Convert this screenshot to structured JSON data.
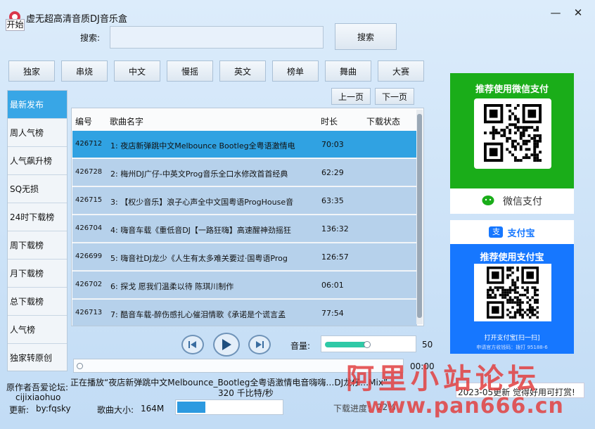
{
  "window": {
    "title": "虚无超高清音质DJ音乐盒",
    "start_label": "开始",
    "minimize_glyph": "—",
    "close_glyph": "✕"
  },
  "search": {
    "label": "搜索:",
    "value": "",
    "button_label": "搜索"
  },
  "categories": [
    "独家",
    "串烧",
    "中文",
    "慢摇",
    "英文",
    "榜单",
    "舞曲",
    "大赛"
  ],
  "paging": {
    "prev_label": "上一页",
    "next_label": "下一页"
  },
  "sidebar": {
    "items": [
      "最新发布",
      "周人气榜",
      "人气飙升榜",
      "SQ无损",
      "24时下载榜",
      "周下载榜",
      "月下载榜",
      "总下载榜",
      "人气榜",
      "独家转原创"
    ],
    "active_index": 0
  },
  "list": {
    "columns": {
      "id": "编号",
      "title": "歌曲名字",
      "duration": "时长",
      "download_status": "下载状态"
    },
    "rows": [
      {
        "id": "426712",
        "title": "1: 夜店新弹跳中文Melbounce Bootleg全粤语激情电",
        "duration": "70:03",
        "status": "",
        "selected": true
      },
      {
        "id": "426728",
        "title": "2: 梅州DJ广仔-中英文Prog音乐全口水修改首首经典",
        "duration": "62:29",
        "status": "",
        "selected": false
      },
      {
        "id": "426715",
        "title": "3: 【权少音乐】浪子心声全中文国粤语ProgHouse音",
        "duration": "63:35",
        "status": "",
        "selected": false
      },
      {
        "id": "426704",
        "title": "4: 嗨音车载《重低音DJ【一路狂嗨】高速醒神劲摇狂",
        "duration": "136:32",
        "status": "",
        "selected": false
      },
      {
        "id": "426699",
        "title": "5: 嗨音社DJ龙少《人生有太多难关要过·国粤语Prog",
        "duration": "126:57",
        "status": "",
        "selected": false
      },
      {
        "id": "426702",
        "title": "6: 探戈     愿我们温柔以待  陈琪川制作",
        "duration": "06:01",
        "status": "",
        "selected": false
      },
      {
        "id": "426713",
        "title": "7: 酷音车载-醉伤感扎心催泪情歌《承诺是个谎言孟",
        "duration": "77:54",
        "status": "",
        "selected": false
      }
    ]
  },
  "player": {
    "prev_icon": "skip-previous",
    "play_icon": "play",
    "next_icon": "skip-next",
    "volume_label": "音量:",
    "volume_value": "50",
    "volume_level": 0.5,
    "time": "00:00",
    "progress": 0.0
  },
  "status": {
    "author_label": "原作者吾爱论坛:",
    "author_name": "cijixiaohuo",
    "update_label": "更新:",
    "update_by": "by:fqsky",
    "now_playing": "正在播放“夜店新弹跳中文Melbounce_Bootleg全粤语激情电音嗨嗨…DJ龙仔…Mix”",
    "bitrate": "320 千比特/秒",
    "size_label": "歌曲大小:",
    "size_value": "164M",
    "size_fill": 0.27,
    "download_label": "下载进度：",
    "download_value": "22%",
    "download_fill": 0.22,
    "notice_prefix": "2",
    "notice": "2023-05更新 觉得好用可打赏!"
  },
  "pay": {
    "wechat_title": "推荐使用微信支付",
    "wechat_name": "微信支付",
    "alipay_name": "支付宝",
    "alipay_title": "推荐使用支付宝",
    "alipay_scan": "打开支付宝[扫一扫]",
    "alipay_note": "申请官方收钱码：拨打 95188-6"
  },
  "watermark": {
    "line1": "阿里小站论坛",
    "line2": "www.pan666.cn"
  },
  "colors": {
    "accent": "#38a6e6",
    "selected_row": "#30a2e2",
    "row_bg": "#b6d1eb",
    "wechat": "#1aad19",
    "alipay": "#1677ff",
    "watermark": "#e24040"
  }
}
